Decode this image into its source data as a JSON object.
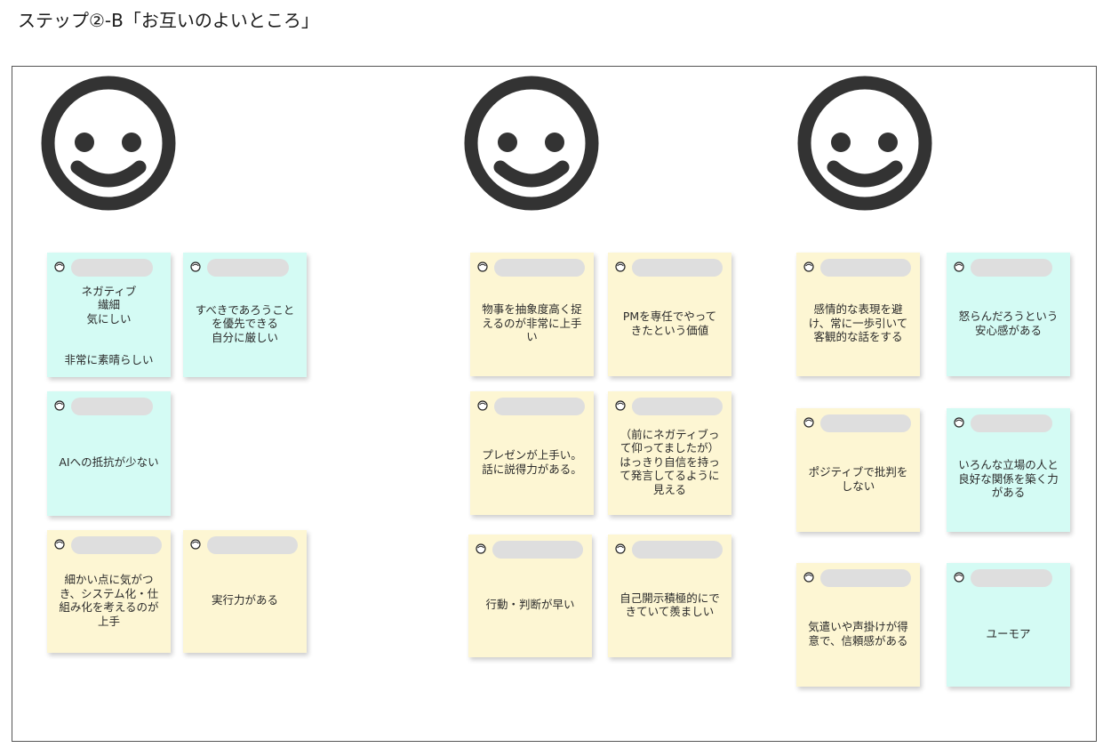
{
  "title": "ステップ②-B「お互いのよいところ」",
  "colors": {
    "cyan": "#d4fbf4",
    "yellow": "#fdf6d3",
    "smiley": "#333333"
  },
  "columns": [
    {
      "icon": "smiley-face-icon",
      "notes": [
        {
          "text": "ネガティブ\n繊細\n気にしい\n\n\n非常に素晴らしい",
          "color": "cyan"
        },
        {
          "text": "すべきであろうこと\nを優先できる\n自分に厳しい",
          "color": "cyan"
        },
        {
          "text": "AIへの抵抗が少ない",
          "color": "cyan"
        },
        {
          "text": "細かい点に気がつ\nき、システム化・仕\n組み化を考えるのが\n上手",
          "color": "yellow"
        },
        {
          "text": "実行力がある",
          "color": "yellow"
        }
      ]
    },
    {
      "icon": "smiley-face-icon",
      "notes": [
        {
          "text": "物事を抽象度高く捉\nえるのが非常に上手\nい",
          "color": "yellow"
        },
        {
          "text": "PMを専任でやって\nきたという価値",
          "color": "yellow"
        },
        {
          "text": "プレゼンが上手い。\n話に説得力がある。",
          "color": "yellow"
        },
        {
          "text": "（前にネガティブっ\nて仰ってましたが）\nはっきり自信を持っ\nて発言してるように\n見える",
          "color": "yellow"
        },
        {
          "text": "行動・判断が早い",
          "color": "yellow"
        },
        {
          "text": "自己開示積極的にで\nきていて羨ましい",
          "color": "yellow"
        }
      ]
    },
    {
      "icon": "smiley-face-icon",
      "notes": [
        {
          "text": "感情的な表現を避\nけ、常に一歩引いて\n客観的な話をする",
          "color": "yellow"
        },
        {
          "text": "怒らんだろうという\n安心感がある",
          "color": "cyan"
        },
        {
          "text": "ポジティブで批判を\nしない",
          "color": "yellow"
        },
        {
          "text": "いろんな立場の人と\n良好な関係を築く力\nがある",
          "color": "cyan"
        },
        {
          "text": "気遣いや声掛けが得\n意で、信頼感がある",
          "color": "yellow"
        },
        {
          "text": "ユーモア",
          "color": "cyan"
        }
      ]
    }
  ]
}
